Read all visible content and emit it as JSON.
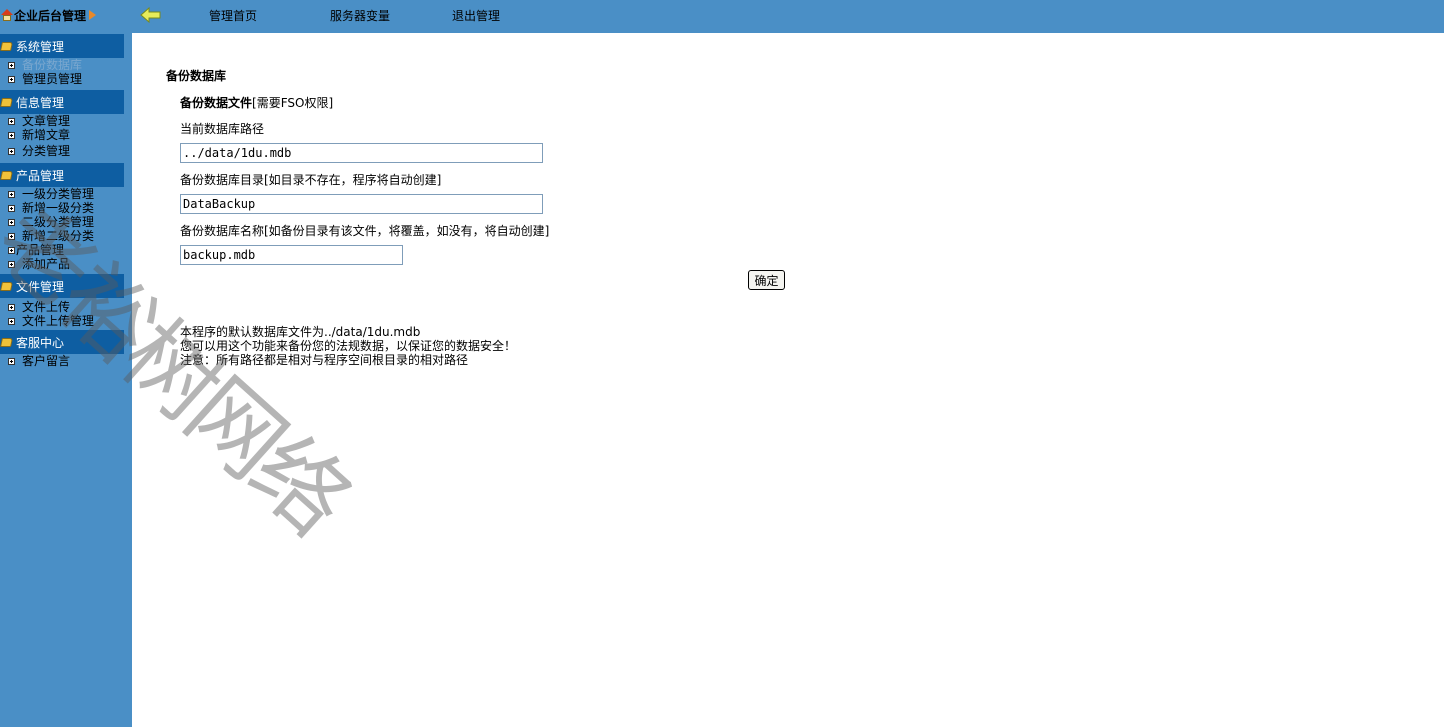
{
  "sidebar": {
    "title": "企业后台管理",
    "sections": [
      {
        "label": "系统管理",
        "items": [
          "备份数据库",
          "管理员管理"
        ]
      },
      {
        "label": "信息管理",
        "items": [
          "文章管理",
          "新增文章",
          "分类管理"
        ]
      },
      {
        "label": "产品管理",
        "items": [
          "一级分类管理",
          "新增一级分类",
          "二级分类管理",
          "新增二级分类",
          "产品管理",
          "添加产品"
        ]
      },
      {
        "label": "文件管理",
        "items": [
          "文件上传",
          "文件上传管理"
        ]
      },
      {
        "label": "客服中心",
        "items": [
          "客户留言"
        ]
      }
    ]
  },
  "topnav": {
    "home": "管理首页",
    "server_vars": "服务器变量",
    "logout": "退出管理"
  },
  "form": {
    "page_heading": "备份数据库",
    "section_title": "备份数据文件",
    "section_note": "[需要FSO权限]",
    "current_path_label": "当前数据库路径",
    "current_path_value": "../data/1du.mdb",
    "backup_dir_label": "备份数据库目录[如目录不存在，程序将自动创建]",
    "backup_dir_value": "DataBackup",
    "backup_name_label": "备份数据库名称[如备份目录有该文件，将覆盖，如没有，将自动创建]",
    "backup_name_value": "backup.mdb",
    "submit_label": "确定"
  },
  "notes": [
    "本程序的默认数据库文件为../data/1du.mdb",
    "您可以用这个功能来备份您的法规数据，以保证您的数据安全！",
    "注意：所有路径都是相对与程序空间根目录的相对路径"
  ],
  "watermark": "老裕树网络",
  "colors": {
    "sidebar_bg": "#4a8fc6",
    "section_header_bg": "#0e5ea2",
    "topbar_bg": "#4a8fc6"
  }
}
